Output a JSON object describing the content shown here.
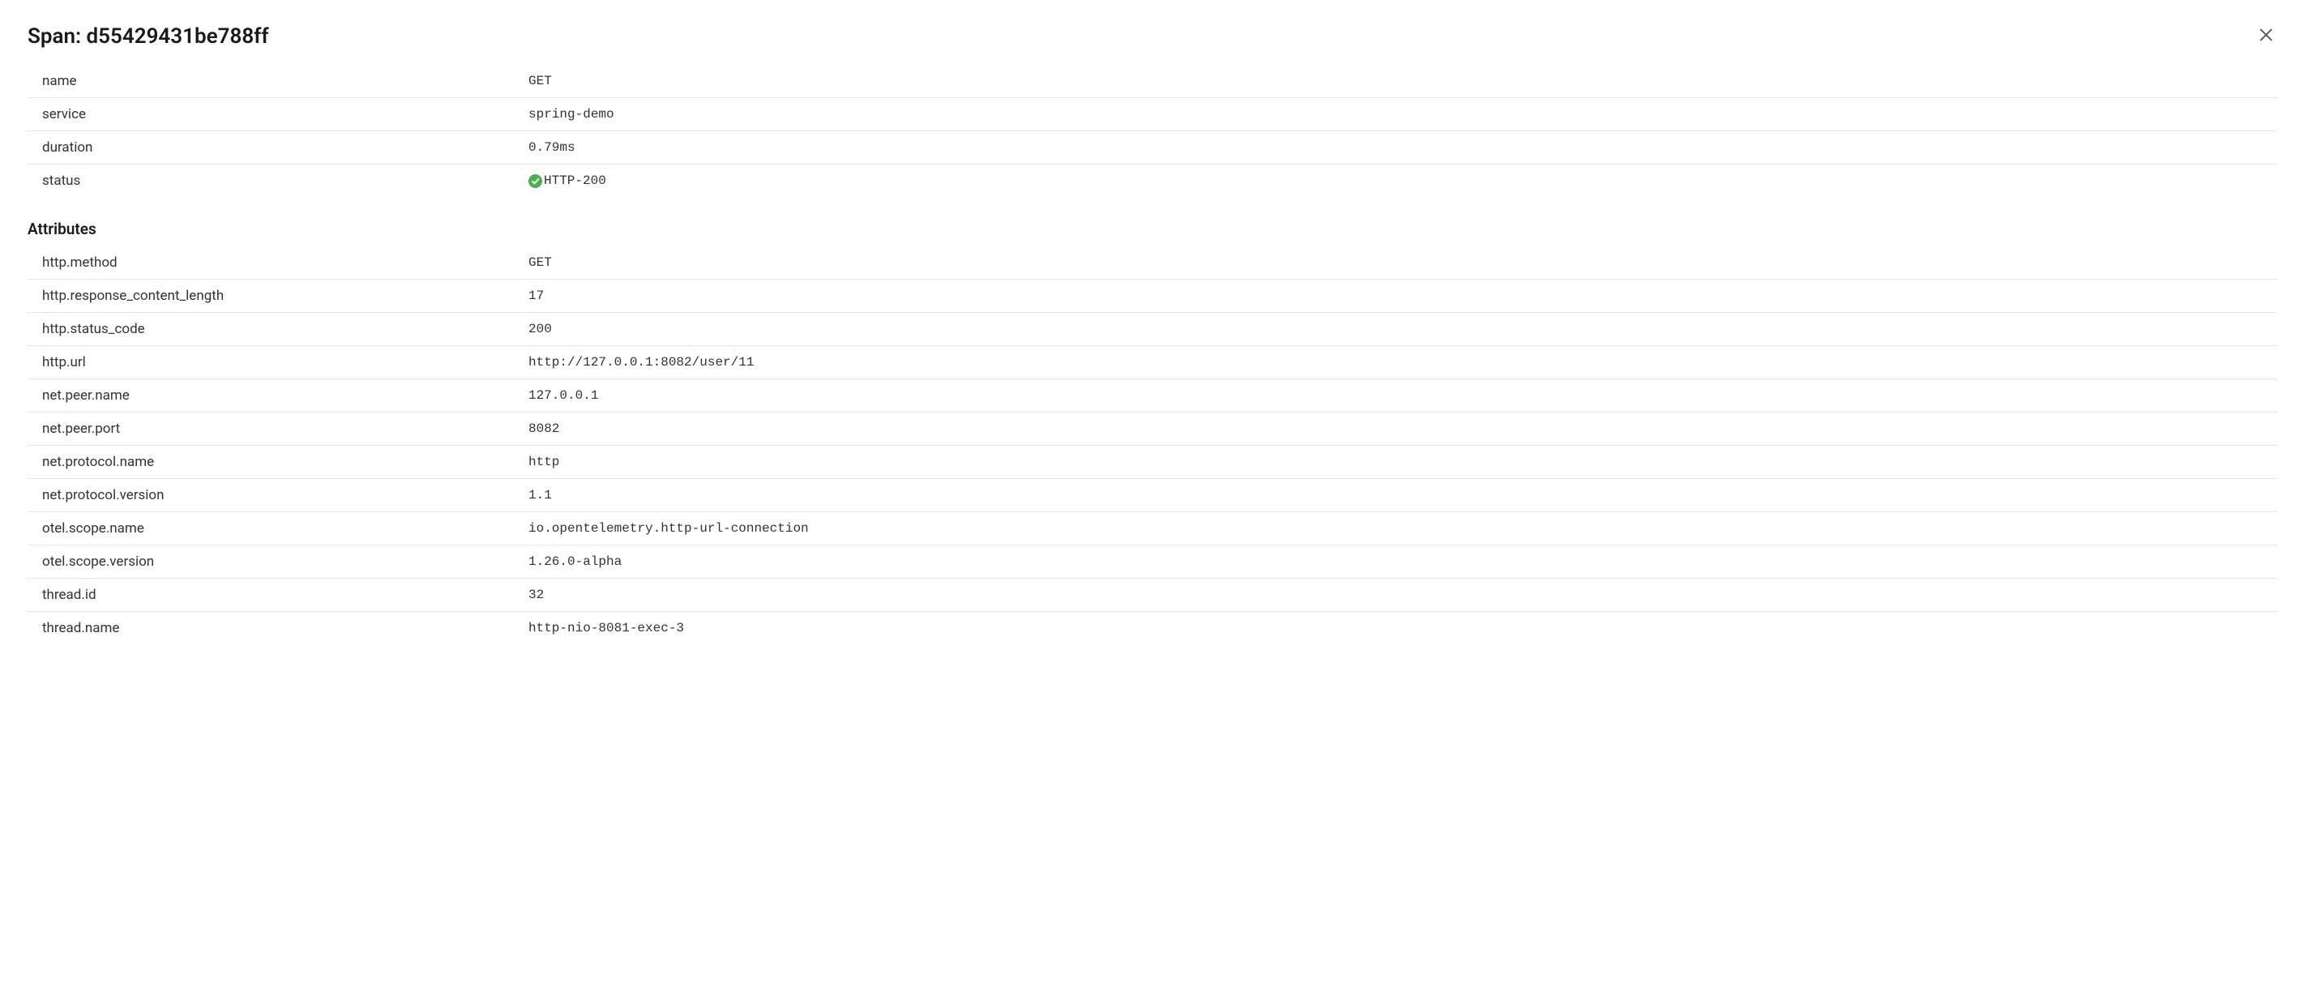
{
  "header": {
    "title": "Span: d55429431be788ff"
  },
  "summary": {
    "rows": [
      {
        "key": "name",
        "value": "GET"
      },
      {
        "key": "service",
        "value": "spring-demo"
      },
      {
        "key": "duration",
        "value": "0.79ms"
      },
      {
        "key": "status",
        "value": "HTTP-200",
        "statusOk": true
      }
    ]
  },
  "attributes": {
    "title": "Attributes",
    "rows": [
      {
        "key": "http.method",
        "value": "GET"
      },
      {
        "key": "http.response_content_length",
        "value": "17"
      },
      {
        "key": "http.status_code",
        "value": "200"
      },
      {
        "key": "http.url",
        "value": "http://127.0.0.1:8082/user/11"
      },
      {
        "key": "net.peer.name",
        "value": "127.0.0.1"
      },
      {
        "key": "net.peer.port",
        "value": "8082"
      },
      {
        "key": "net.protocol.name",
        "value": "http"
      },
      {
        "key": "net.protocol.version",
        "value": "1.1"
      },
      {
        "key": "otel.scope.name",
        "value": "io.opentelemetry.http-url-connection"
      },
      {
        "key": "otel.scope.version",
        "value": "1.26.0-alpha"
      },
      {
        "key": "thread.id",
        "value": "32"
      },
      {
        "key": "thread.name",
        "value": "http-nio-8081-exec-3"
      }
    ]
  }
}
